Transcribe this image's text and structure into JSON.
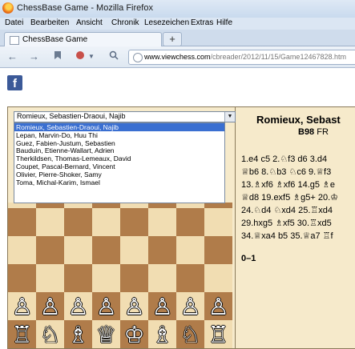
{
  "window": {
    "title": "ChessBase Game - Mozilla Firefox"
  },
  "menu": [
    "Datei",
    "Bearbeiten",
    "Ansicht",
    "Chronik",
    "Lesezeichen",
    "Extras",
    "Hilfe"
  ],
  "tab": {
    "label": "ChessBase Game",
    "new_tab": "+"
  },
  "nav": {
    "back": "←",
    "forward": "→"
  },
  "address": {
    "domain": "www.viewchess.com",
    "path": "/cbreader/2012/11/15/Game12467828.htm"
  },
  "facebook": {
    "label": "f"
  },
  "game_select": {
    "value": "Romieux, Sebastien-Draoui, Najib",
    "options": [
      "Romieux, Sebastien-Draoui, Najib",
      "Lepan, Marvin-Do, Huu Thi",
      "Guez, Fabien-Justum, Sebastien",
      "Bauduin, Etienne-Wallart, Adrien",
      "Therkildsen, Thomas-Lemeaux, David",
      "Coupet, Pascal-Bernard, Vincent",
      "Olivier, Pierre-Shoker, Samy",
      "Toma, Michal-Karim, Ismael"
    ]
  },
  "board": {
    "row7": [
      "♙",
      "♙",
      "♙",
      "♙",
      "♙",
      "♙",
      "♙",
      "♙"
    ],
    "row8": [
      "♖",
      "♘",
      "♗",
      "♕",
      "♔",
      "♗",
      "♘",
      "♖"
    ]
  },
  "game": {
    "players": "Romieux, Sebast",
    "eco": "B98",
    "event": "FR",
    "moves": [
      "1.e4  c5  2.♘f3  d6  3.d4",
      "♕b6  8.♘b3  ♘c6  9.♕f3",
      "13.♗xf6  ♗xf6  14.g5  ♗e",
      "♕d8  19.exf5  ♗g5+  20.♔",
      "24.♘d4  ♘xd4  25.♖xd4",
      "29.hxg5  ♗xf5  30.♖xd5",
      "34.♕xa4  b5  35.♕a7  ♖f"
    ],
    "result": "0–1"
  }
}
